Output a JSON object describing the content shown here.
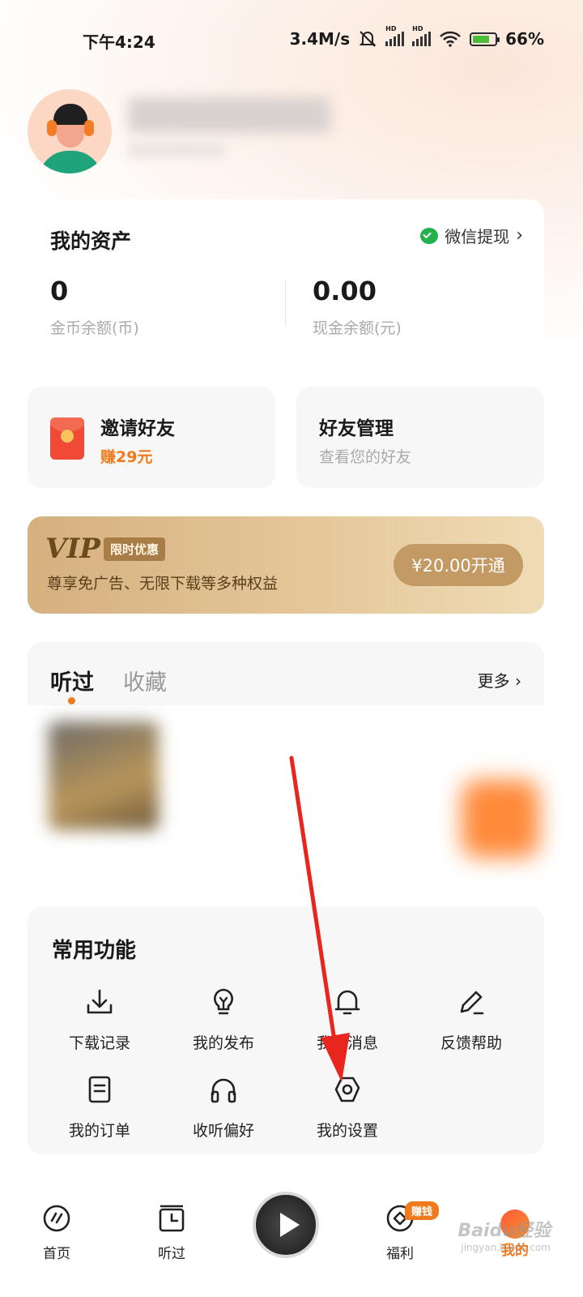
{
  "status_bar": {
    "time": "下午4:24",
    "speed": "3.4M/s",
    "battery_text": "66%"
  },
  "assets": {
    "title": "我的资产",
    "wechat_label": "微信提现",
    "coins_value": "0",
    "coins_label": "金币余额(币)",
    "cash_value": "0.00",
    "cash_label": "现金余额(元)"
  },
  "invite": {
    "title": "邀请好友",
    "reward": "赚29元"
  },
  "friends": {
    "title": "好友管理",
    "subtitle": "查看您的好友"
  },
  "vip": {
    "logo": "VIP",
    "tag": "限时优惠",
    "subtitle": "尊享免广告、无限下载等多种权益",
    "button": "¥20.00开通"
  },
  "history": {
    "tab_listened": "听过",
    "tab_favorites": "收藏",
    "more": "更多"
  },
  "functions": {
    "title": "常用功能",
    "items": [
      {
        "label": "下载记录",
        "icon": "download-icon"
      },
      {
        "label": "我的发布",
        "icon": "lightbulb-icon"
      },
      {
        "label": "我的消息",
        "icon": "bell-icon"
      },
      {
        "label": "反馈帮助",
        "icon": "pencil-icon"
      },
      {
        "label": "我的订单",
        "icon": "order-icon"
      },
      {
        "label": "收听偏好",
        "icon": "headphones-icon"
      },
      {
        "label": "我的设置",
        "icon": "settings-icon"
      }
    ]
  },
  "bottom_nav": {
    "home": "首页",
    "listened": "听过",
    "welfare": "福利",
    "earn_badge": "赚钱",
    "me": "我的"
  },
  "watermark": {
    "brand": "Baidu经验",
    "url": "jingyan.baidu.com"
  },
  "colors": {
    "accent": "#f07a1c",
    "vip_gold": "#c39a63",
    "wechat_green": "#22b14c",
    "annotation_arrow": "#e8261e"
  }
}
